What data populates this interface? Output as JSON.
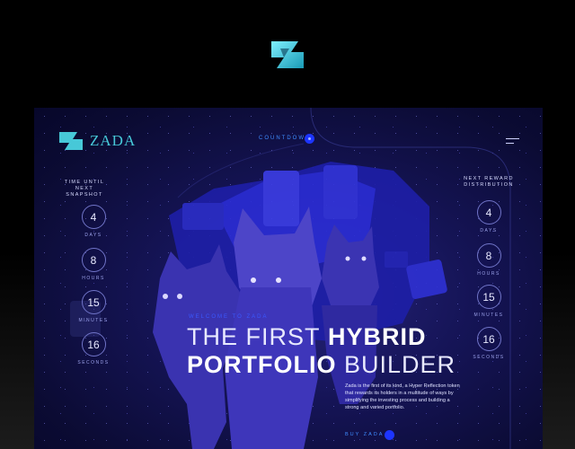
{
  "brand": {
    "name": "ZADA"
  },
  "nav": {
    "countdown_label": "COUNTDOWN"
  },
  "left_panel": {
    "title": "TIME UNTIL NEXT SNAPSHOT",
    "timers": [
      {
        "value": "4",
        "label": "DAYS"
      },
      {
        "value": "8",
        "label": "HOURS"
      },
      {
        "value": "15",
        "label": "MINUTES"
      },
      {
        "value": "16",
        "label": "SECONDS"
      }
    ]
  },
  "right_panel": {
    "title": "NEXT REWARD DISTRIBUTION",
    "timers": [
      {
        "value": "4",
        "label": "DAYS"
      },
      {
        "value": "8",
        "label": "HOURS"
      },
      {
        "value": "15",
        "label": "MINUTES"
      },
      {
        "value": "16",
        "label": "SECONDS"
      }
    ]
  },
  "hero": {
    "welcome": "WELCOME TO ZADA",
    "line1_light": "THE FIRST",
    "line1_bold": "HYBRID",
    "line2_bold": "PORTFOLIO",
    "line2_light": "BUILDER",
    "description": "Zada is the first of its kind, a Hyper Reflection token that rewards its holders in a multitude of ways by simplifying the investing process and building a strong and varied portfolio.",
    "cta_label": "BUY ZADA"
  },
  "colors": {
    "accent": "#1d35ff",
    "brand": "#47c8d8",
    "background": "#151456"
  }
}
